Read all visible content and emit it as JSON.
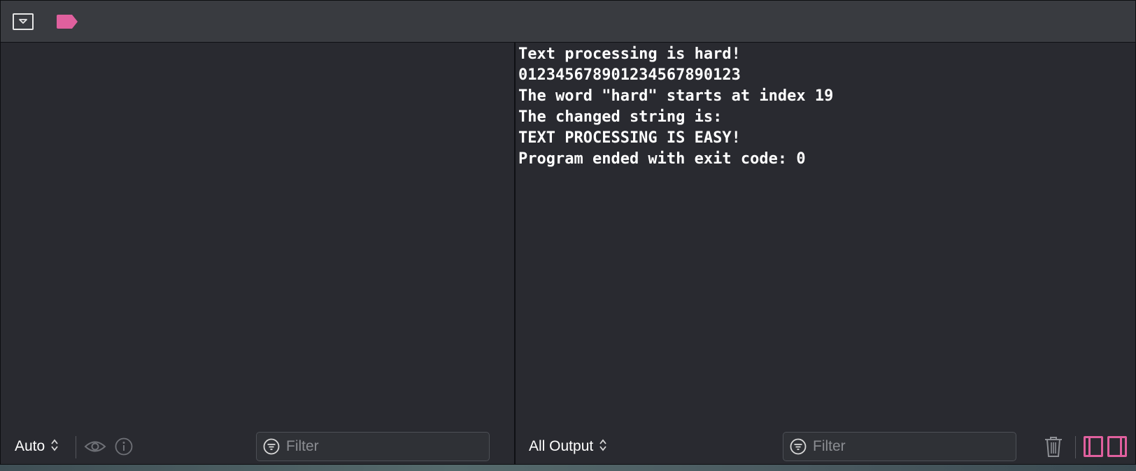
{
  "toolbar": {
    "hide_debug_icon": "hide-debug-area-icon",
    "breakpoint_icon": "breakpoint-icon",
    "breakpoint_color": "#e0609e"
  },
  "console": {
    "lines": [
      "Text processing is hard!",
      "012345678901234567890123",
      "The word \"hard\" starts at index 19",
      "The changed string is:",
      "TEXT PROCESSING IS EASY!",
      "Program ended with exit code: 0"
    ]
  },
  "variables_bar": {
    "scope_label": "Auto",
    "eye_icon": "eye-icon",
    "info_icon": "info-icon",
    "filter_placeholder": "Filter"
  },
  "console_bar": {
    "output_label": "All Output",
    "filter_placeholder": "Filter",
    "trash_icon": "trash-icon",
    "accent_color": "#e0609e"
  }
}
